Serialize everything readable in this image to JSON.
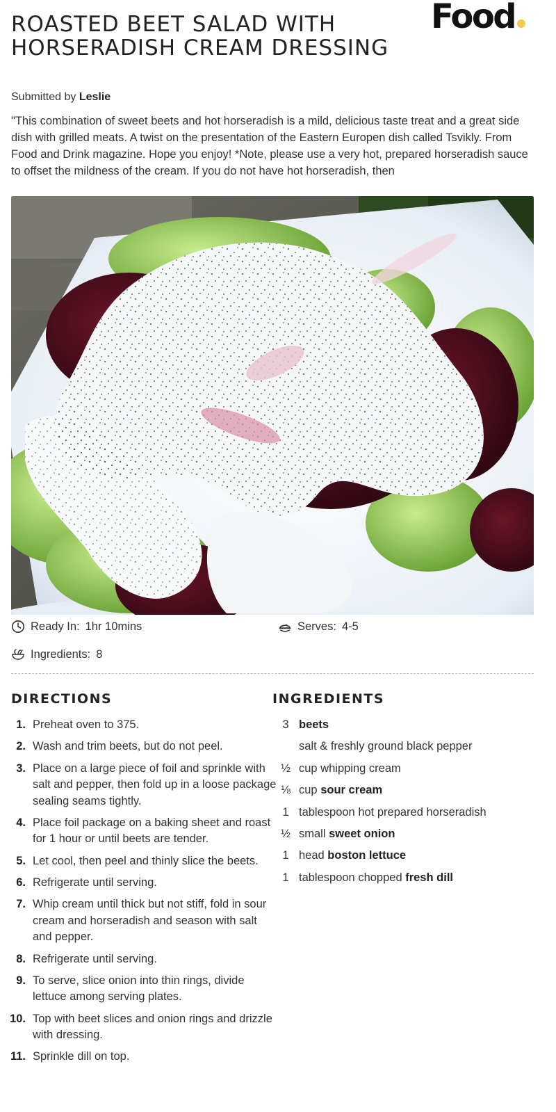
{
  "brand": {
    "logo_text": "Food",
    "accent": "#f2c94c"
  },
  "recipe": {
    "title": "ROASTED BEET SALAD WITH HORSERADISH CREAM DRESSING",
    "submitted_prefix": "Submitted by",
    "author": "Leslie",
    "description": "\"This combination of sweet beets and hot horseradish is a mild, delicious taste treat and a great side dish with grilled meats. A twist on the presentation of the Eastern Europen dish called Tsvikly. From Food and Drink magazine. Hope you enjoy! *Note, please use a very hot, prepared horseradish sauce to offset the mildness of the cream. If you do not have hot horseradish, then"
  },
  "meta": {
    "ready_label": "Ready In:",
    "ready_value": "1hr 10mins",
    "serves_label": "Serves:",
    "serves_value": "4-5",
    "ingredients_label": "Ingredients:",
    "ingredients_value": "8"
  },
  "directions": {
    "heading": "DIRECTIONS",
    "steps": [
      {
        "n": "1.",
        "text": "Preheat oven to 375."
      },
      {
        "n": "2.",
        "text": "Wash and trim beets, but do not peel."
      },
      {
        "n": "3.",
        "text": "Place on a large piece of foil and sprinkle with salt and pepper, then fold up in a loose package sealing seams tightly."
      },
      {
        "n": "4.",
        "text": "Place foil package on a baking sheet and roast for 1 hour or until beets are tender."
      },
      {
        "n": "5.",
        "text": "Let cool, then peel and thinly slice the beets."
      },
      {
        "n": "6.",
        "text": "Refrigerate until serving."
      },
      {
        "n": "7.",
        "text": "Whip cream until thick but not stiff, fold in sour cream and horseradish and season with salt and pepper."
      },
      {
        "n": "8.",
        "text": "Refrigerate until serving."
      },
      {
        "n": "9.",
        "text": "To serve, slice onion into thin rings, divide lettuce among serving plates."
      },
      {
        "n": "10.",
        "text": "Top with beet slices and onion rings and drizzle with dressing."
      },
      {
        "n": "11.",
        "text": "Sprinkle dill on top."
      }
    ]
  },
  "ingredients": {
    "heading": "INGREDIENTS",
    "items": [
      {
        "qty": "3",
        "pre": "",
        "bold": "beets"
      },
      {
        "qty": "",
        "pre": "salt & freshly ground black pepper",
        "bold": ""
      },
      {
        "qty": "½",
        "pre": "cup whipping cream",
        "bold": ""
      },
      {
        "qty": "⅛",
        "pre": "cup ",
        "bold": "sour cream"
      },
      {
        "qty": "1",
        "pre": "tablespoon hot prepared horseradish",
        "bold": ""
      },
      {
        "qty": "½",
        "pre": "small ",
        "bold": "sweet onion"
      },
      {
        "qty": "1",
        "pre": "head ",
        "bold": "boston lettuce"
      },
      {
        "qty": "1",
        "pre": "tablespoon chopped ",
        "bold": "fresh dill"
      }
    ]
  }
}
